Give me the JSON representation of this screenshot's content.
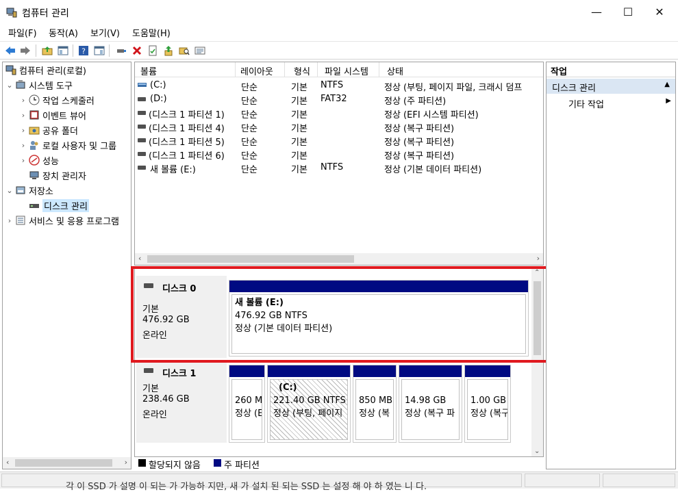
{
  "window": {
    "title": "컴퓨터 관리",
    "minimize": "—",
    "maximize": "☐",
    "close": "✕"
  },
  "menu": [
    "파일(F)",
    "동작(A)",
    "보기(V)",
    "도움말(H)"
  ],
  "tree": {
    "root": "컴퓨터 관리(로컬)",
    "system_tools": "시스템 도구",
    "task_scheduler": "작업 스케줄러",
    "event_viewer": "이벤트 뷰어",
    "shared_folders": "공유 폴더",
    "local_users": "로컬 사용자 및 그룹",
    "performance": "성능",
    "device_manager": "장치 관리자",
    "storage": "저장소",
    "disk_management": "디스크 관리",
    "services": "서비스 및 응용 프로그램"
  },
  "volume_list": {
    "columns": [
      "볼륨",
      "레이아웃",
      "형식",
      "파일 시스템",
      "상태"
    ],
    "rows": [
      {
        "volume": "(C:)",
        "layout": "단순",
        "type": "기본",
        "fs": "NTFS",
        "status": "정상 (부팅, 페이지 파일, 크래시 덤프"
      },
      {
        "volume": "(D:)",
        "layout": "단순",
        "type": "기본",
        "fs": "FAT32",
        "status": "정상 (주 파티션)"
      },
      {
        "volume": "(디스크 1 파티션 1)",
        "layout": "단순",
        "type": "기본",
        "fs": "",
        "status": "정상 (EFI 시스템 파티션)"
      },
      {
        "volume": "(디스크 1 파티션 4)",
        "layout": "단순",
        "type": "기본",
        "fs": "",
        "status": "정상 (복구 파티션)"
      },
      {
        "volume": "(디스크 1 파티션 5)",
        "layout": "단순",
        "type": "기본",
        "fs": "",
        "status": "정상 (복구 파티션)"
      },
      {
        "volume": "(디스크 1 파티션 6)",
        "layout": "단순",
        "type": "기본",
        "fs": "",
        "status": "정상 (복구 파티션)"
      },
      {
        "volume": "새 볼륨 (E:)",
        "layout": "단순",
        "type": "기본",
        "fs": "NTFS",
        "status": "정상 (기본 데이터 파티션)"
      }
    ]
  },
  "disks": [
    {
      "name": "디스크 0",
      "type": "기본",
      "size": "476.92 GB",
      "state": "온라인",
      "partitions": [
        {
          "title": "새 볼륨  (E:)",
          "line2": "476.92 GB NTFS",
          "line3": "정상 (기본 데이터 파티션)"
        }
      ]
    },
    {
      "name": "디스크 1",
      "type": "기본",
      "size": "238.46 GB",
      "state": "온라인",
      "partitions": [
        {
          "title": "",
          "line2": "260 M",
          "line3": "정상 (E"
        },
        {
          "title": "(C:)",
          "line2": "221.40 GB NTFS",
          "line3": "정상 (부팅, 페이지"
        },
        {
          "title": "",
          "line2": "850 MB",
          "line3": "정상 (복"
        },
        {
          "title": "",
          "line2": "14.98 GB",
          "line3": "정상 (복구 파"
        },
        {
          "title": "",
          "line2": "1.00 GB",
          "line3": "정상 (복구"
        }
      ]
    }
  ],
  "legend": {
    "unallocated": "할당되지 않음",
    "primary": "주 파티션"
  },
  "actions": {
    "header": "작업",
    "selected": "디스크 관리",
    "more": "기타 작업"
  },
  "colors": {
    "partition_bar": "#000a82",
    "highlight": "#e0191f",
    "selection": "#cce8ff"
  },
  "bottom_text": "각 이 SSD 가 설명 이 되는 가 가능하 지만, 새 가 설치 된 되는 SSD 는 설정 해 야 하 였는 니 다."
}
